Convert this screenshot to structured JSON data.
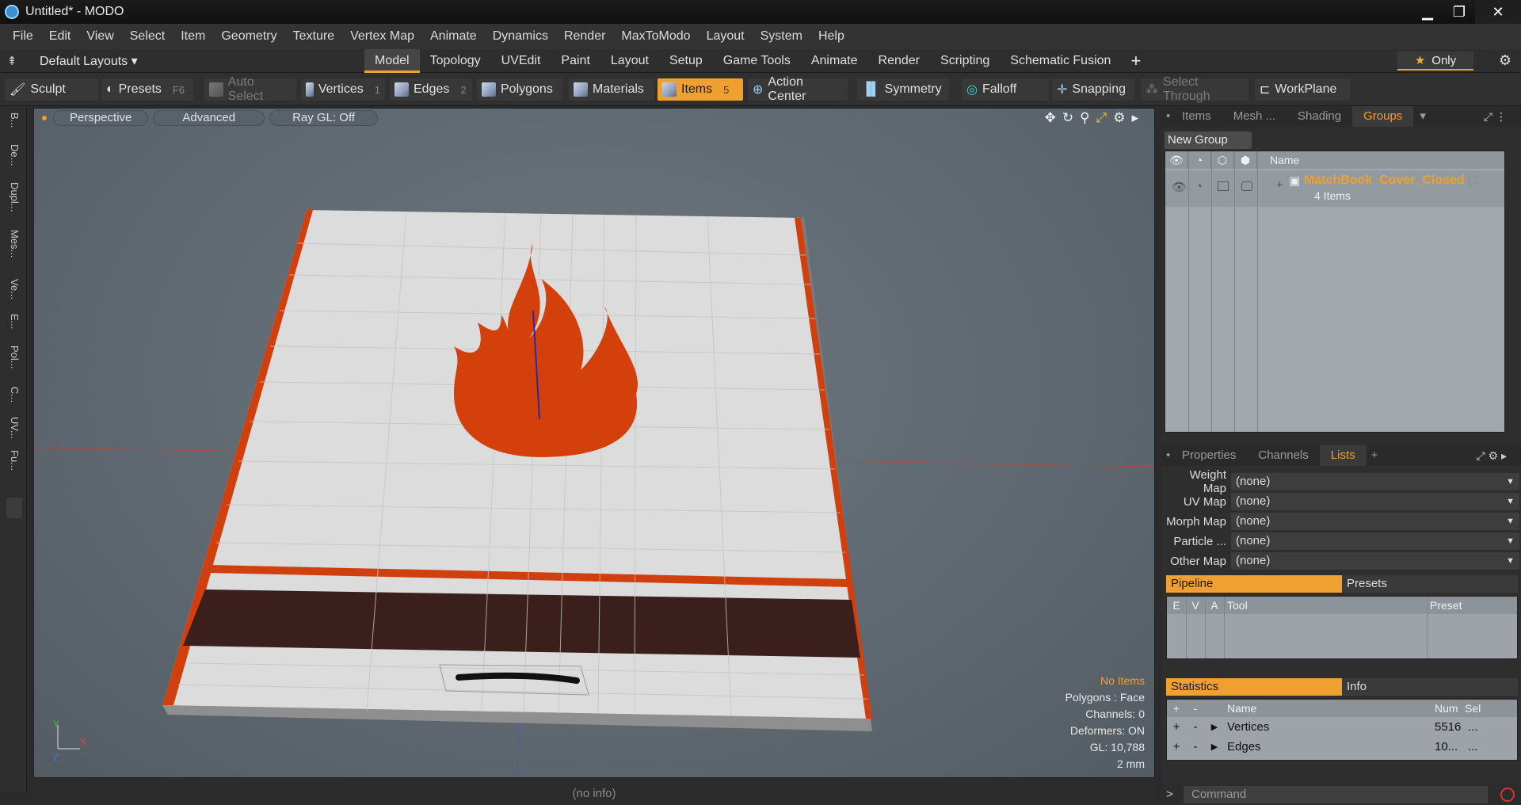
{
  "window": {
    "title": "Untitled* - MODO",
    "controls": [
      "▁",
      "❐",
      "✕"
    ]
  },
  "menu": [
    "File",
    "Edit",
    "View",
    "Select",
    "Item",
    "Geometry",
    "Texture",
    "Vertex Map",
    "Animate",
    "Dynamics",
    "Render",
    "MaxToModo",
    "Layout",
    "System",
    "Help"
  ],
  "layouts": {
    "dropdown": "Default Layouts",
    "tabs": [
      "Model",
      "Topology",
      "UVEdit",
      "Paint",
      "Layout",
      "Setup",
      "Game Tools",
      "Animate",
      "Render",
      "Scripting",
      "Schematic Fusion"
    ],
    "active_tab": "Model",
    "plus": "+",
    "only": "Only"
  },
  "toolbar": {
    "sculpt": "Sculpt",
    "presets": "Presets",
    "presets_key": "F6",
    "auto_select": "Auto Select",
    "vertices": "Vertices",
    "vertices_key": "1",
    "edges": "Edges",
    "edges_key": "2",
    "polygons": "Polygons",
    "materials": "Materials",
    "items": "Items",
    "items_key": "5",
    "action_center": "Action Center",
    "symmetry": "Symmetry",
    "falloff": "Falloff",
    "snapping": "Snapping",
    "select_through": "Select Through",
    "workplane": "WorkPlane"
  },
  "left_tabs": [
    "B...",
    "De...",
    "Dupl...",
    "Mes...",
    "Ve...",
    "E...",
    "Pol...",
    "C...",
    "UV...",
    "Fu..."
  ],
  "viewport": {
    "view": "Perspective",
    "mode": "Advanced",
    "raygl": "Ray GL: Off",
    "stats": {
      "selection": "No Items",
      "polygons": "Polygons : Face",
      "channels": "Channels: 0",
      "deformers": "Deformers: ON",
      "gl": "GL: 10,788",
      "scale": "2 mm"
    },
    "axis_x": "X",
    "axis_y": "Y",
    "axis_z": "Z",
    "accent": "#f0a030",
    "flame_color": "#d4400c",
    "strip_color": "#3a1f1c"
  },
  "status_bar": "(no info)",
  "right_panel": {
    "top_tabs": [
      "Items",
      "Mesh ...",
      "Shading",
      "Groups"
    ],
    "active_top_tab": "Groups",
    "new_group": "New Group",
    "groups_header_name": "Name",
    "group": {
      "name": "MatchBook_Cover_Closed",
      "suffix": "(3 ...",
      "count": "4 Items"
    },
    "mid_tabs": [
      "Properties",
      "Channels",
      "Lists"
    ],
    "active_mid_tab": "Lists",
    "maps": [
      {
        "label": "Weight Map",
        "value": "(none)"
      },
      {
        "label": "UV Map",
        "value": "(none)"
      },
      {
        "label": "Morph Map",
        "value": "(none)"
      },
      {
        "label": "Particle ...",
        "value": "(none)"
      },
      {
        "label": "Other Map",
        "value": "(none)"
      }
    ],
    "pipeline_tab": "Pipeline",
    "presets_tab": "Presets",
    "pipeline_cols": {
      "e": "E",
      "v": "V",
      "a": "A",
      "tool": "Tool",
      "preset": "Preset"
    },
    "stats_tab": "Statistics",
    "info_tab": "Info",
    "stats_cols": {
      "plus": "+",
      "minus": "-",
      "name": "Name",
      "num": "Num",
      "sel": "Sel"
    },
    "stats_rows": [
      {
        "name": "Vertices",
        "num": "5516",
        "sel": "..."
      },
      {
        "name": "Edges",
        "num": "10...",
        "sel": "..."
      }
    ]
  },
  "command": {
    "placeholder": "Command"
  }
}
